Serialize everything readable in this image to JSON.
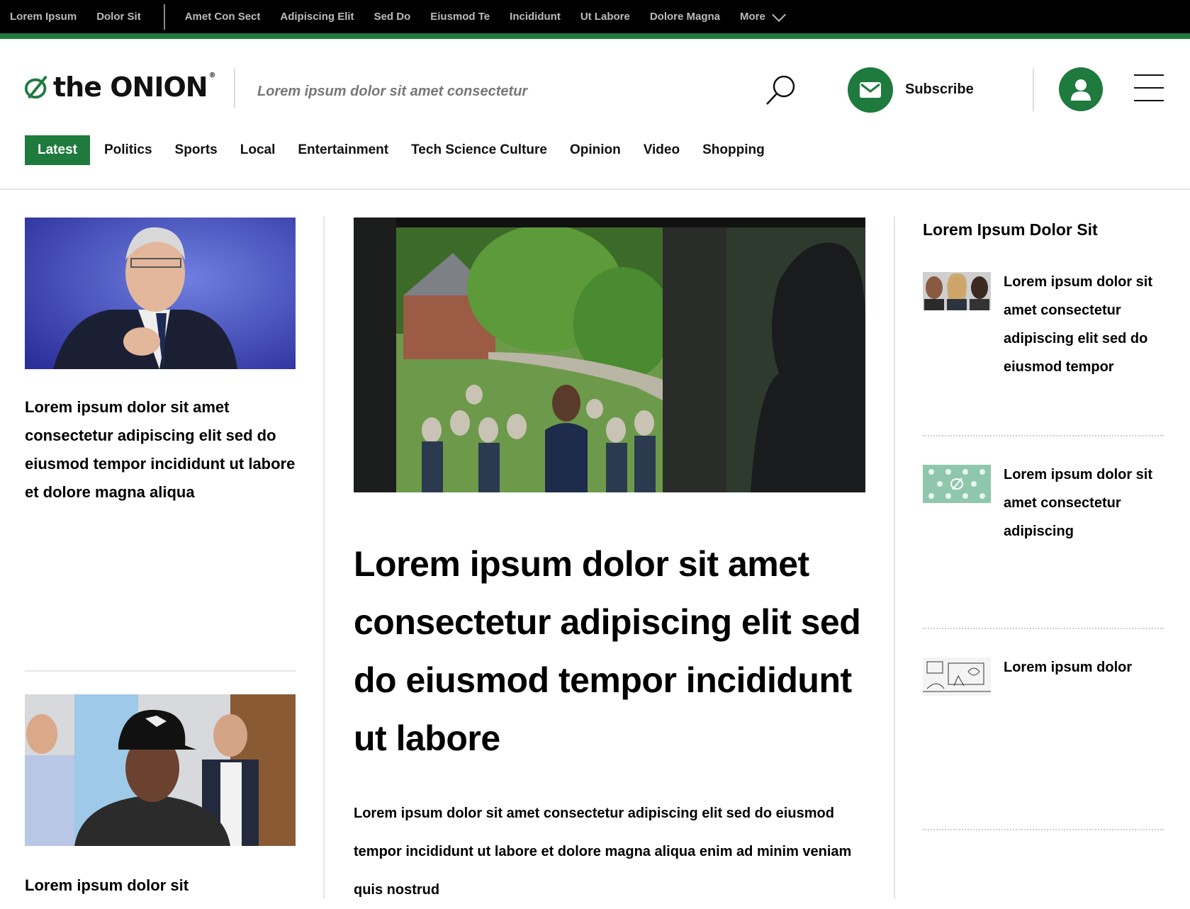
{
  "topbar": {
    "brand_links": [
      "Lorem Ipsum",
      "Dolor Sit"
    ],
    "categories": [
      "Amet Con Sect",
      "Adipiscing Elit",
      "Sed Do",
      "Eiusmod Te",
      "Incididunt",
      "Ut Labore",
      "Dolore Magna"
    ],
    "more_label": "More"
  },
  "header": {
    "logo_the": "the",
    "logo_onion": "ONION",
    "logo_reg": "®",
    "tagline": "Lorem ipsum dolor sit amet consectetur",
    "newsletter_label": "Subscribe"
  },
  "nav": {
    "items": [
      "Latest",
      "Politics",
      "Sports",
      "Local",
      "Entertainment",
      "Tech Science Culture",
      "Opinion",
      "Video",
      "Shopping"
    ]
  },
  "left": {
    "card1_title": "Lorem ipsum dolor sit amet consectetur adipiscing elit sed do eiusmod tempor incididunt ut labore et dolore magna aliqua",
    "card2_title": "Lorem ipsum dolor sit"
  },
  "center": {
    "headline": "Lorem ipsum dolor sit amet consectetur adipiscing elit sed do eiusmod tempor incididunt ut labore",
    "dek": "Lorem ipsum dolor sit amet consectetur adipiscing elit sed do eiusmod tempor incididunt ut labore et dolore magna aliqua enim ad minim veniam quis nostrud"
  },
  "right": {
    "heading": "Lorem Ipsum Dolor Sit",
    "trending": [
      {
        "title": "Lorem ipsum dolor sit amet consectetur adipiscing elit sed do eiusmod tempor"
      },
      {
        "title": "Lorem ipsum dolor sit amet consectetur adipiscing"
      },
      {
        "title": "Lorem ipsum dolor"
      }
    ]
  },
  "colors": {
    "brand_green": "#1f7a3e",
    "topbar_bg": "#000000",
    "rule": "#e6e6e6"
  }
}
